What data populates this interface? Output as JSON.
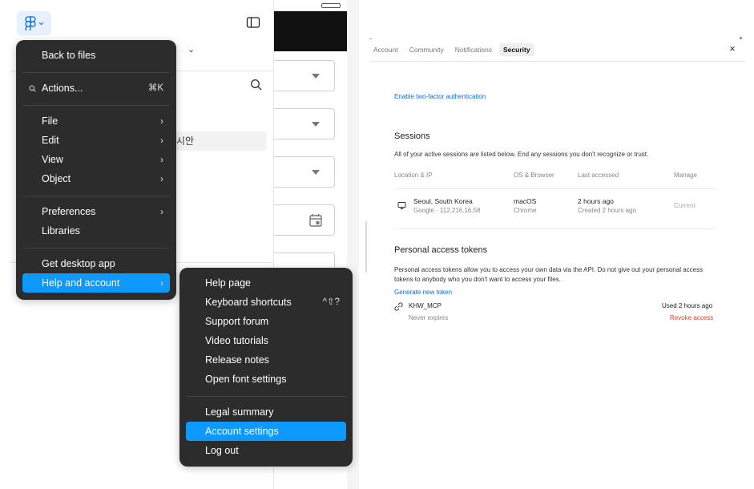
{
  "editor": {
    "korean_text": "시안"
  },
  "main_menu": {
    "back": "Back to files",
    "actions": "Actions...",
    "actions_shortcut": "⌘K",
    "file": "File",
    "edit": "Edit",
    "view": "View",
    "object": "Object",
    "preferences": "Preferences",
    "libraries": "Libraries",
    "desktop_app": "Get desktop app",
    "help": "Help and account",
    "chevron": "›"
  },
  "help_menu": {
    "help_page": "Help page",
    "keyboard_shortcuts": "Keyboard shortcuts",
    "keyboard_shortcuts_key": "^⇧?",
    "support_forum": "Support forum",
    "video_tutorials": "Video tutorials",
    "release_notes": "Release notes",
    "font_settings": "Open font settings",
    "legal_summary": "Legal summary",
    "account_settings": "Account settings",
    "log_out": "Log out"
  },
  "settings": {
    "tabs": [
      "Account",
      "Community",
      "Notifications",
      "Security"
    ],
    "active_tab": "Security",
    "close": "×",
    "twofa_link": "Enable two-factor authentication",
    "sessions": {
      "title": "Sessions",
      "description": "All of your active sessions are listed below. End any sessions you don't recognize or trust.",
      "columns": [
        "Location & IP",
        "OS & Browser",
        "Last accessed",
        "Manage"
      ],
      "rows": [
        {
          "location": "Seoul, South Korea",
          "ip": "Google · 112.216.16.58",
          "os": "macOS",
          "browser": "Chrome",
          "last": "2 hours ago",
          "created": "Created 2 hours ago",
          "manage": "Current"
        }
      ]
    },
    "tokens": {
      "title": "Personal access tokens",
      "description": "Personal access tokens allow you to access your own data via the API. Do not give out your personal access tokens to anybody who you don't want to access your files.",
      "generate": "Generate new token",
      "items": [
        {
          "name": "KHW_MCP",
          "expiry": "Never expires",
          "used": "Used 2 hours ago",
          "revoke": "Revoke access"
        }
      ]
    }
  },
  "colors": {
    "menu_bg": "#2c2c2c",
    "accent": "#0d99ff",
    "link": "#0d6bd8",
    "danger": "#e03e2d"
  }
}
